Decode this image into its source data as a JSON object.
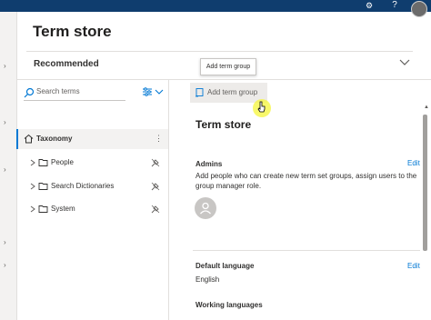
{
  "page": {
    "title": "Term store"
  },
  "recommended": {
    "label": "Recommended"
  },
  "tooltip": {
    "text": "Add term group"
  },
  "search": {
    "placeholder": "Search terms"
  },
  "tree": [
    {
      "label": "Taxonomy",
      "icon": "home-icon",
      "selected": true
    },
    {
      "label": "People",
      "icon": "folder-icon"
    },
    {
      "label": "Search Dictionaries",
      "icon": "folder-icon"
    },
    {
      "label": "System",
      "icon": "folder-icon"
    }
  ],
  "toolbar": {
    "add_term_group": "Add term group"
  },
  "details": {
    "title": "Term store",
    "admins": {
      "label": "Admins",
      "edit": "Edit",
      "description_line1": "Add people who can create new term set groups, assign users to the",
      "description_line2": "group manager role."
    },
    "default_language": {
      "label": "Default language",
      "edit": "Edit",
      "value": "English"
    },
    "working_languages": {
      "label": "Working languages"
    }
  },
  "colors": {
    "accent": "#0078d4",
    "topbar": "#0f3d6e",
    "selected_bg": "#f3f2f1"
  }
}
